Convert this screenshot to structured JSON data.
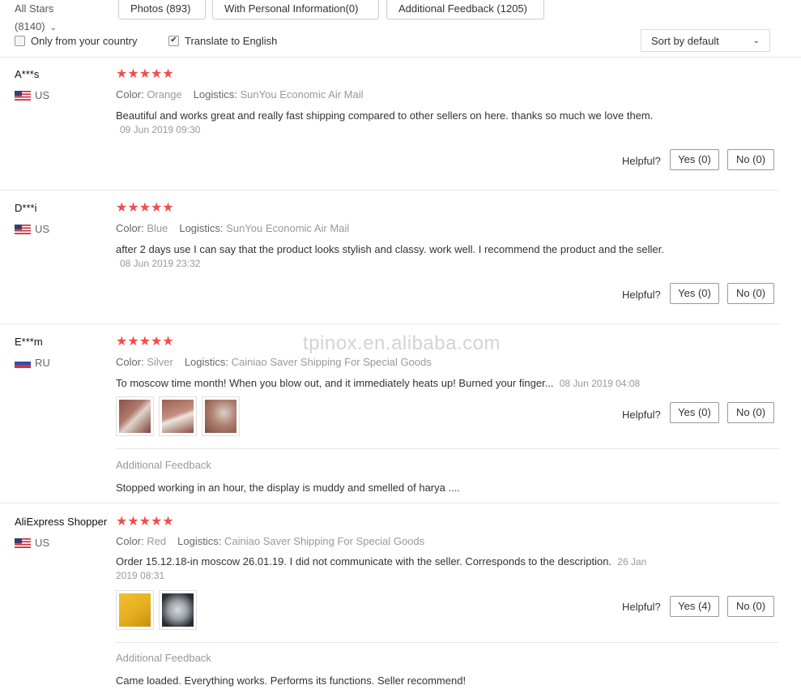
{
  "filters": {
    "all_stars": "All Stars (8140)",
    "photos": "Photos (893)",
    "personal_info": "With Personal Information(0)",
    "additional_feedback": "Additional Feedback (1205)",
    "only_country": "Only from your country",
    "translate": "Translate to English",
    "translate_checked": true,
    "only_country_checked": false,
    "sort": "Sort by default"
  },
  "labels": {
    "color": "Color:",
    "logistics": "Logistics:",
    "helpful": "Helpful?",
    "additional_feedback_title": "Additional Feedback"
  },
  "colors": {
    "star": "#f44b4b",
    "meta": "#999999"
  },
  "watermark": "tpinox.en.alibaba.com",
  "reviews": [
    {
      "user": "A***s",
      "country": "US",
      "flag": "us",
      "stars": 5,
      "color": "Orange",
      "logistics": "SunYou Economic Air Mail",
      "text": "Beautiful and works great and really fast shipping compared to other sellers on here. thanks so much we love them.",
      "date": "09 Jun 2019 09:30",
      "yes": "Yes (0)",
      "no": "No (0)"
    },
    {
      "user": "D***i",
      "country": "US",
      "flag": "us",
      "stars": 5,
      "color": "Blue",
      "logistics": "SunYou Economic Air Mail",
      "text": "after 2 days use I can say that the product looks stylish and classy. work well. I recommend the product and the seller.",
      "date": "08 Jun 2019 23:32",
      "yes": "Yes (0)",
      "no": "No (0)"
    },
    {
      "user": "E***m",
      "country": "RU",
      "flag": "ru",
      "stars": 5,
      "color": "Silver",
      "logistics": "Cainiao Saver Shipping For Special Goods",
      "text": "To moscow time month! When you blow out, and it immediately heats up! Burned your finger...",
      "date": "08 Jun 2019 04:08",
      "yes": "Yes (0)",
      "no": "No (0)",
      "additional": "Stopped working in an hour, the display is muddy and smelled of harya ...."
    },
    {
      "user": "AliExpress Shopper",
      "country": "US",
      "flag": "us",
      "stars": 5,
      "color": "Red",
      "logistics": "Cainiao Saver Shipping For Special Goods",
      "text": "Order 15.12.18-in moscow 26.01.19. I did not communicate with the seller. Corresponds to the description.",
      "date_a": "26 Jan",
      "date_b": "2019 08:31",
      "yes": "Yes (4)",
      "no": "No (0)",
      "additional": "Came loaded. Everything works. Performs its functions. Seller recommend!"
    }
  ]
}
